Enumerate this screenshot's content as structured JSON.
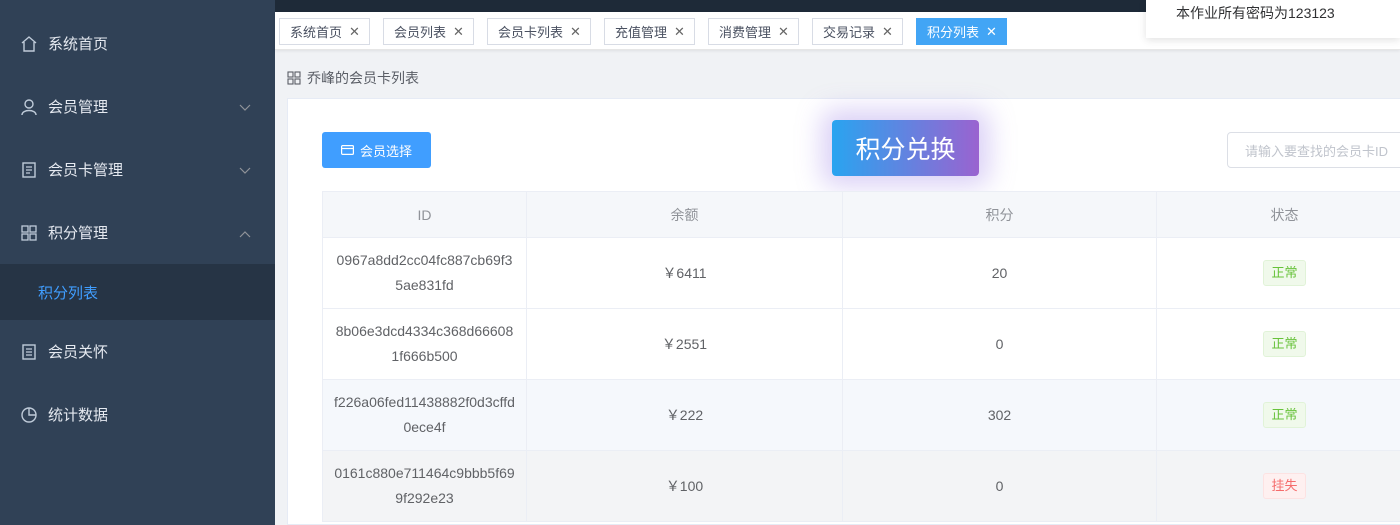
{
  "sidebar": {
    "items": [
      {
        "label": "系统首页"
      },
      {
        "label": "会员管理"
      },
      {
        "label": "会员卡管理"
      },
      {
        "label": "积分管理"
      },
      {
        "label": "积分列表"
      },
      {
        "label": "会员关怀"
      },
      {
        "label": "统计数据"
      }
    ]
  },
  "tabs": [
    {
      "label": "系统首页"
    },
    {
      "label": "会员列表"
    },
    {
      "label": "会员卡列表"
    },
    {
      "label": "充值管理"
    },
    {
      "label": "消费管理"
    },
    {
      "label": "交易记录"
    },
    {
      "label": "积分列表"
    }
  ],
  "notice": "本作业所有密码为123123",
  "breadcrumb": "乔峰的会员卡列表",
  "toolbar": {
    "select_label": "会员选择",
    "redeem_label": "积分兑换",
    "search_placeholder": "请输入要查找的会员卡ID"
  },
  "table": {
    "headers": [
      "ID",
      "余额",
      "积分",
      "状态"
    ],
    "rows": [
      {
        "id": "0967a8dd2cc04fc887cb69f35ae831fd",
        "balance": "￥6411",
        "points": "20",
        "status": "正常"
      },
      {
        "id": "8b06e3dcd4334c368d666081f666b500",
        "balance": "￥2551",
        "points": "0",
        "status": "正常"
      },
      {
        "id": "f226a06fed11438882f0d3cffd0ece4f",
        "balance": "￥222",
        "points": "302",
        "status": "正常"
      },
      {
        "id": "0161c880e711464c9bbb5f699f292e23",
        "balance": "￥100",
        "points": "0",
        "status": "挂失"
      }
    ]
  },
  "colors": {
    "sidebar_bg": "#304156",
    "accent": "#409eff",
    "ok": "#67c23a",
    "lost": "#f56c6c"
  }
}
